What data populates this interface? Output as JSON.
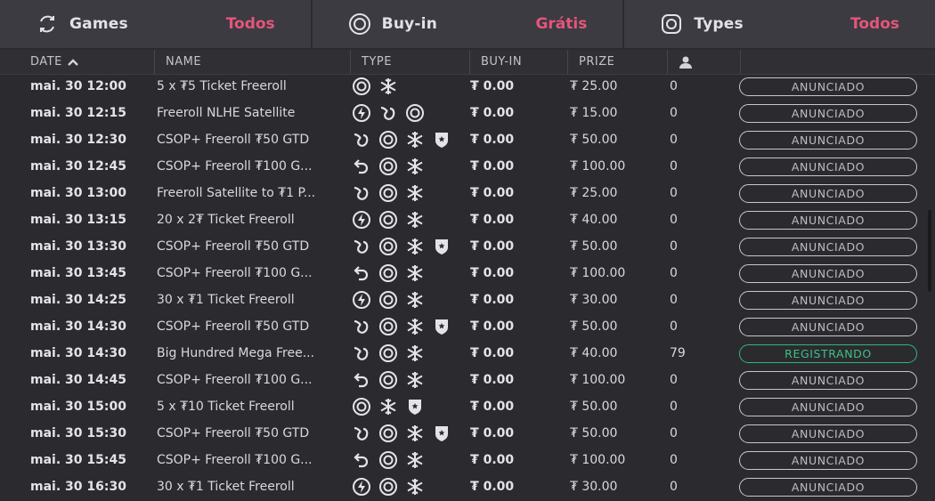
{
  "filters": [
    {
      "label": "Games",
      "value": "Todos",
      "icon": "games-cycle-icon"
    },
    {
      "label": "Buy-in",
      "value": "Grátis",
      "icon": "chip-icon"
    },
    {
      "label": "Types",
      "value": "Todos",
      "icon": "types-chip-icon"
    }
  ],
  "columns": {
    "date": "DATE",
    "name": "NAME",
    "type": "TYPE",
    "buyin": "BUY-IN",
    "prize": "PRIZE",
    "players_icon": "person-icon"
  },
  "colors": {
    "accent_pink": "#e5557a",
    "registering_green": "#2fb77a"
  },
  "rows": [
    {
      "date": "mai. 30 12:00",
      "name": "5 x ₮5 Ticket Freeroll",
      "types": [
        "chip",
        "snowflake"
      ],
      "buyin": "₮ 0.00",
      "prize": "₮ 25.00",
      "players": "0",
      "status": "ANUNCIADO"
    },
    {
      "date": "mai. 30 12:15",
      "name": "Freeroll NLHE Satellite",
      "types": [
        "turbo",
        "satellite",
        "chip"
      ],
      "buyin": "₮ 0.00",
      "prize": "₮ 15.00",
      "players": "0",
      "status": "ANUNCIADO"
    },
    {
      "date": "mai. 30 12:30",
      "name": "CSOP+ Freeroll ₮50 GTD",
      "types": [
        "satellite",
        "chip",
        "snowflake",
        "shield"
      ],
      "buyin": "₮ 0.00",
      "prize": "₮ 50.00",
      "players": "0",
      "status": "ANUNCIADO"
    },
    {
      "date": "mai. 30 12:45",
      "name": "CSOP+ Freeroll ₮100 G...",
      "types": [
        "rebuy",
        "chip",
        "snowflake"
      ],
      "buyin": "₮ 0.00",
      "prize": "₮ 100.00",
      "players": "0",
      "status": "ANUNCIADO"
    },
    {
      "date": "mai. 30 13:00",
      "name": "Freeroll Satellite to ₮1 P...",
      "types": [
        "satellite",
        "chip",
        "snowflake"
      ],
      "buyin": "₮ 0.00",
      "prize": "₮ 25.00",
      "players": "0",
      "status": "ANUNCIADO"
    },
    {
      "date": "mai. 30 13:15",
      "name": "20 x 2₮ Ticket Freeroll",
      "types": [
        "turbo",
        "chip",
        "snowflake"
      ],
      "buyin": "₮ 0.00",
      "prize": "₮ 40.00",
      "players": "0",
      "status": "ANUNCIADO"
    },
    {
      "date": "mai. 30 13:30",
      "name": "CSOP+ Freeroll ₮50 GTD",
      "types": [
        "satellite",
        "chip",
        "snowflake",
        "shield"
      ],
      "buyin": "₮ 0.00",
      "prize": "₮ 50.00",
      "players": "0",
      "status": "ANUNCIADO"
    },
    {
      "date": "mai. 30 13:45",
      "name": "CSOP+ Freeroll ₮100 G...",
      "types": [
        "rebuy",
        "chip",
        "snowflake"
      ],
      "buyin": "₮ 0.00",
      "prize": "₮ 100.00",
      "players": "0",
      "status": "ANUNCIADO"
    },
    {
      "date": "mai. 30 14:25",
      "name": "30 x ₮1 Ticket Freeroll",
      "types": [
        "turbo",
        "chip",
        "snowflake"
      ],
      "buyin": "₮ 0.00",
      "prize": "₮ 30.00",
      "players": "0",
      "status": "ANUNCIADO"
    },
    {
      "date": "mai. 30 14:30",
      "name": "CSOP+ Freeroll ₮50 GTD",
      "types": [
        "satellite",
        "chip",
        "snowflake",
        "shield"
      ],
      "buyin": "₮ 0.00",
      "prize": "₮ 50.00",
      "players": "0",
      "status": "ANUNCIADO"
    },
    {
      "date": "mai. 30 14:30",
      "name": "Big Hundred Mega Free...",
      "types": [
        "satellite",
        "chip",
        "snowflake"
      ],
      "buyin": "₮ 0.00",
      "prize": "₮ 40.00",
      "players": "79",
      "status": "REGISTRANDO"
    },
    {
      "date": "mai. 30 14:45",
      "name": "CSOP+ Freeroll ₮100 G...",
      "types": [
        "rebuy",
        "chip",
        "snowflake"
      ],
      "buyin": "₮ 0.00",
      "prize": "₮ 100.00",
      "players": "0",
      "status": "ANUNCIADO"
    },
    {
      "date": "mai. 30 15:00",
      "name": "5 x ₮10 Ticket Freeroll",
      "types": [
        "chip",
        "snowflake",
        "shield"
      ],
      "buyin": "₮ 0.00",
      "prize": "₮ 50.00",
      "players": "0",
      "status": "ANUNCIADO"
    },
    {
      "date": "mai. 30 15:30",
      "name": "CSOP+ Freeroll ₮50 GTD",
      "types": [
        "satellite",
        "chip",
        "snowflake",
        "shield"
      ],
      "buyin": "₮ 0.00",
      "prize": "₮ 50.00",
      "players": "0",
      "status": "ANUNCIADO"
    },
    {
      "date": "mai. 30 15:45",
      "name": "CSOP+ Freeroll ₮100 G...",
      "types": [
        "rebuy",
        "chip",
        "snowflake"
      ],
      "buyin": "₮ 0.00",
      "prize": "₮ 100.00",
      "players": "0",
      "status": "ANUNCIADO"
    },
    {
      "date": "mai. 30 16:30",
      "name": "30 x ₮1 Ticket Freeroll",
      "types": [
        "turbo",
        "chip",
        "snowflake"
      ],
      "buyin": "₮ 0.00",
      "prize": "₮ 30.00",
      "players": "0",
      "status": "ANUNCIADO"
    }
  ]
}
